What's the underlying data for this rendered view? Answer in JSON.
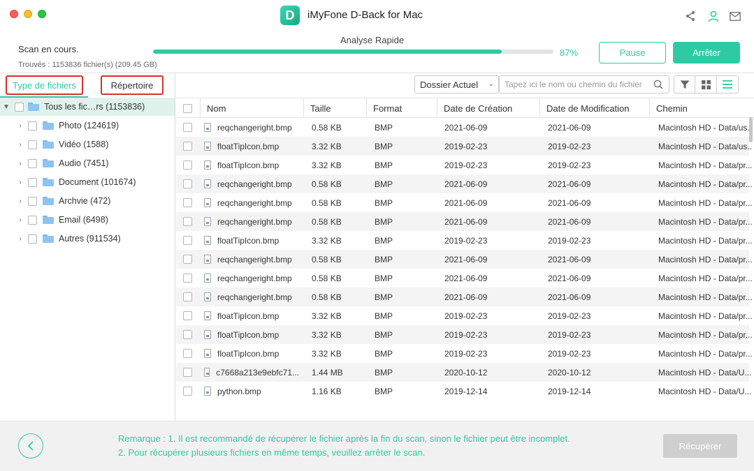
{
  "app": {
    "title": "iMyFone D-Back for Mac",
    "logo_letter": "D"
  },
  "scan": {
    "status": "Scan en cours.",
    "found": "Trouvés : 1153836 fichier(s) (209.45 GB)",
    "mode": "Analyse Rapide",
    "progress": 0.87,
    "progress_label": "87%",
    "pause_label": "Pause",
    "stop_label": "Arrêter"
  },
  "left_tabs": {
    "type_label": "Type de fichiers",
    "dir_label": "Répertoire"
  },
  "tree": {
    "root": "Tous les fic…rs (1153836)",
    "items": [
      {
        "label": "Photo (124619)"
      },
      {
        "label": "Vidéo (1588)"
      },
      {
        "label": "Audio (7451)"
      },
      {
        "label": "Document (101674)"
      },
      {
        "label": "Archvie (472)"
      },
      {
        "label": "Email (6498)"
      },
      {
        "label": "Autres (911534)"
      }
    ]
  },
  "toolbar": {
    "folder_select": "Dossier Actuel",
    "search_placeholder": "Tapez ici le nom ou chemin du fichier"
  },
  "table": {
    "headers": [
      "Nom",
      "Taille",
      "Format",
      "Date de Création",
      "Date de Modification",
      "Chemin"
    ],
    "rows": [
      [
        "reqchangeright.bmp",
        "0.58 KB",
        "BMP",
        "2021-06-09",
        "2021-06-09",
        "Macintosh HD - Data/us..."
      ],
      [
        "floatTipIcon.bmp",
        "3.32 KB",
        "BMP",
        "2019-02-23",
        "2019-02-23",
        "Macintosh HD - Data/us..."
      ],
      [
        "floatTipIcon.bmp",
        "3.32 KB",
        "BMP",
        "2019-02-23",
        "2019-02-23",
        "Macintosh HD - Data/pr..."
      ],
      [
        "reqchangeright.bmp",
        "0.58 KB",
        "BMP",
        "2021-06-09",
        "2021-06-09",
        "Macintosh HD - Data/pr..."
      ],
      [
        "reqchangeright.bmp",
        "0.58 KB",
        "BMP",
        "2021-06-09",
        "2021-06-09",
        "Macintosh HD - Data/pr..."
      ],
      [
        "reqchangeright.bmp",
        "0.58 KB",
        "BMP",
        "2021-06-09",
        "2021-06-09",
        "Macintosh HD - Data/pr..."
      ],
      [
        "floatTipIcon.bmp",
        "3.32 KB",
        "BMP",
        "2019-02-23",
        "2019-02-23",
        "Macintosh HD - Data/pr..."
      ],
      [
        "reqchangeright.bmp",
        "0.58 KB",
        "BMP",
        "2021-06-09",
        "2021-06-09",
        "Macintosh HD - Data/pr..."
      ],
      [
        "reqchangeright.bmp",
        "0.58 KB",
        "BMP",
        "2021-06-09",
        "2021-06-09",
        "Macintosh HD - Data/pr..."
      ],
      [
        "reqchangeright.bmp",
        "0.58 KB",
        "BMP",
        "2021-06-09",
        "2021-06-09",
        "Macintosh HD - Data/pr..."
      ],
      [
        "floatTipIcon.bmp",
        "3.32 KB",
        "BMP",
        "2019-02-23",
        "2019-02-23",
        "Macintosh HD - Data/pr..."
      ],
      [
        "floatTipIcon.bmp",
        "3.32 KB",
        "BMP",
        "2019-02-23",
        "2019-02-23",
        "Macintosh HD - Data/pr..."
      ],
      [
        "floatTipIcon.bmp",
        "3.32 KB",
        "BMP",
        "2019-02-23",
        "2019-02-23",
        "Macintosh HD - Data/pr..."
      ],
      [
        "c7668a213e9ebfc71...",
        "1.44 MB",
        "BMP",
        "2020-10-12",
        "2020-10-12",
        "Macintosh HD - Data/U..."
      ],
      [
        "python.bmp",
        "1.16 KB",
        "BMP",
        "2019-12-14",
        "2019-12-14",
        "Macintosh HD - Data/U..."
      ]
    ]
  },
  "footer": {
    "note_line1": "Remarque : 1. Il est recommandé de récupérer le fichier après la fin du scan, sinon le fichier peut être incomplet.",
    "note_line2": "2. Pour récupérer plusieurs fichiers en même temps, veuillez arrêter le scan.",
    "recover_label": "Récupérer"
  },
  "colors": {
    "accent": "#2fcaa3",
    "highlight_box": "#d9302a",
    "selected_row": "#dff3ec"
  },
  "icons": [
    "share-icon",
    "user-icon",
    "mail-icon",
    "folder-icon",
    "search-icon",
    "filter-icon",
    "grid-view-icon",
    "list-view-icon",
    "file-icon",
    "back-arrow-icon"
  ]
}
